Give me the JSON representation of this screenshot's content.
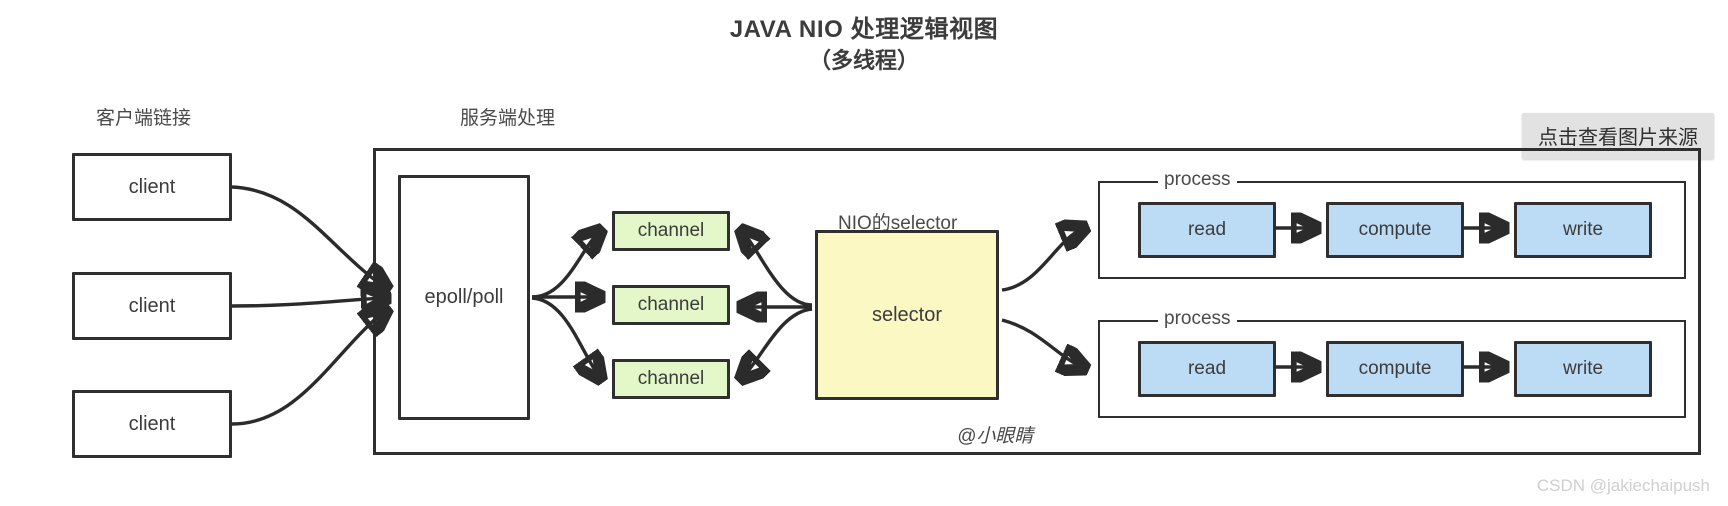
{
  "title": {
    "main": "JAVA NIO 处理逻辑视图",
    "sub": "（多线程）"
  },
  "captions": {
    "client_side": "客户端链接",
    "server_side": "服务端处理",
    "selector_label": "NIO的selector"
  },
  "badge": {
    "label": "点击查看图片来源"
  },
  "clients": [
    {
      "label": "client"
    },
    {
      "label": "client"
    },
    {
      "label": "client"
    }
  ],
  "multiplexer": {
    "label": "epoll/poll"
  },
  "channels": [
    {
      "label": "channel"
    },
    {
      "label": "channel"
    },
    {
      "label": "channel"
    }
  ],
  "selector": {
    "label": "selector",
    "fill": "#fbf8c4"
  },
  "processes": [
    {
      "label": "process",
      "stages": [
        {
          "label": "read"
        },
        {
          "label": "compute"
        },
        {
          "label": "write"
        }
      ]
    },
    {
      "label": "process",
      "stages": [
        {
          "label": "read"
        },
        {
          "label": "compute"
        },
        {
          "label": "write"
        }
      ]
    }
  ],
  "watermarks": {
    "author": "@小眼睛",
    "platform": "CSDN @jakiechaipush"
  },
  "colors": {
    "channel_fill": "#e3f7c8",
    "selector_fill": "#fbf8c4",
    "stage_fill": "#bcdcf5",
    "stroke": "#2f2f2f",
    "badge_bg": "#e2e2e2"
  }
}
